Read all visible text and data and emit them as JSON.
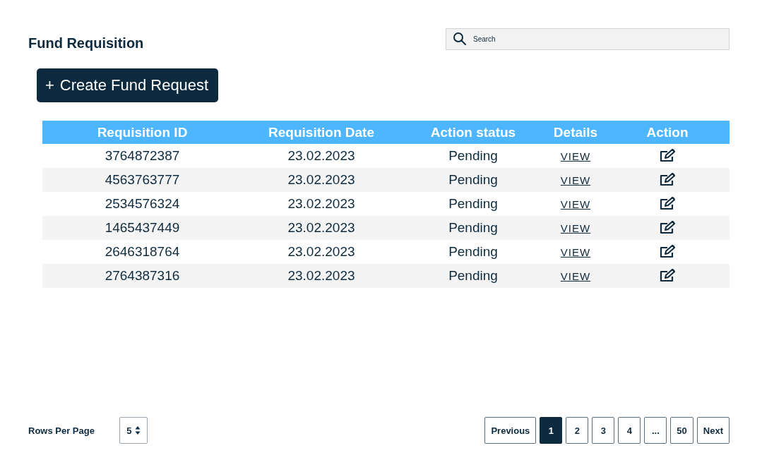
{
  "title": "Fund Requisition",
  "search": {
    "placeholder": "Search"
  },
  "create_button": {
    "icon": "+",
    "label": "Create Fund Request"
  },
  "table": {
    "columns": [
      "Requisition ID",
      "Requisition Date",
      "Action status",
      "Details",
      "Action"
    ],
    "rows": [
      {
        "id": "3764872387",
        "date": "23.02.2023",
        "status": "Pending",
        "details": "VIEW"
      },
      {
        "id": "4563763777",
        "date": "23.02.2023",
        "status": "Pending",
        "details": "VIEW"
      },
      {
        "id": "2534576324",
        "date": "23.02.2023",
        "status": "Pending",
        "details": "VIEW"
      },
      {
        "id": "1465437449",
        "date": "23.02.2023",
        "status": "Pending",
        "details": "VIEW"
      },
      {
        "id": "2646318764",
        "date": "23.02.2023",
        "status": "Pending",
        "details": "VIEW"
      },
      {
        "id": "2764387316",
        "date": "23.02.2023",
        "status": "Pending",
        "details": "VIEW"
      }
    ]
  },
  "rows_per_page": {
    "label": "Rows Per Page",
    "value": "5"
  },
  "pagination": {
    "previous": "Previous",
    "next": "Next",
    "pages": [
      {
        "label": "1",
        "selected": true
      },
      {
        "label": "2",
        "selected": false
      },
      {
        "label": "3",
        "selected": false
      },
      {
        "label": "4",
        "selected": false
      },
      {
        "label": "...",
        "selected": false
      },
      {
        "label": "50",
        "selected": false
      }
    ]
  }
}
